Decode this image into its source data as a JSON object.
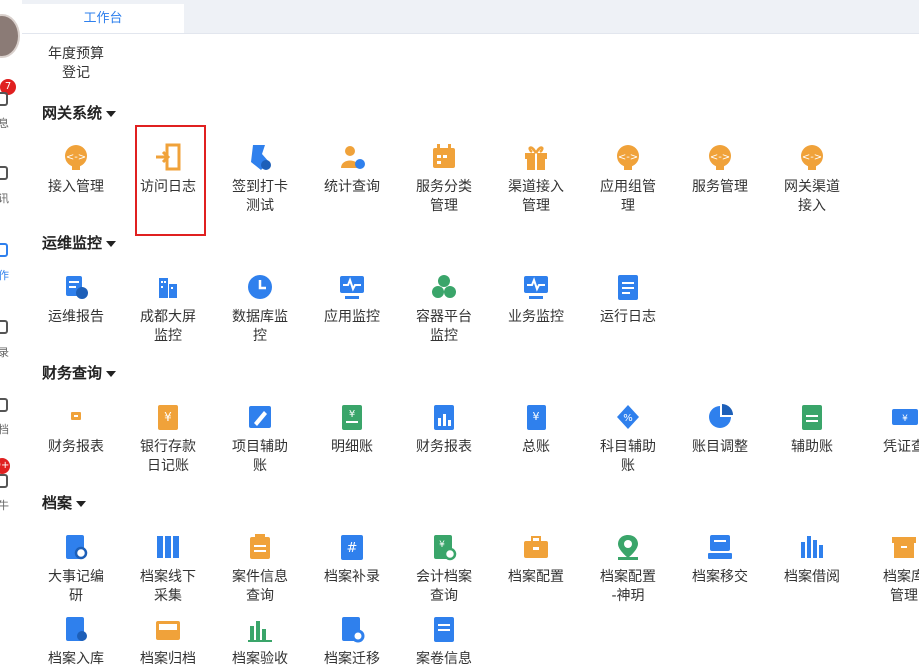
{
  "tabs": {
    "active": "工作台"
  },
  "rail": {
    "labels": [
      "息",
      "讯",
      "作",
      "录",
      "档",
      "牛"
    ],
    "badges": [
      "7",
      "9+"
    ]
  },
  "colors": {
    "accent": "#2f80ed",
    "orange": "#f0a23a",
    "green": "#3aa56a",
    "highlight": "#e02020"
  },
  "top_partial": {
    "label": "年度预算\n登记",
    "icon": "edit-icon"
  },
  "sections": [
    {
      "title": "网关系统",
      "items": [
        {
          "label": "接入管理",
          "icon": "gateway-icon"
        },
        {
          "label": "访问日志",
          "icon": "login-door-icon"
        },
        {
          "label": "签到打卡\n测试",
          "icon": "checkin-icon"
        },
        {
          "label": "统计查询",
          "icon": "user-stat-icon"
        },
        {
          "label": "服务分类\n管理",
          "icon": "calendar-service-icon"
        },
        {
          "label": "渠道接入\n管理",
          "icon": "gift-icon"
        },
        {
          "label": "应用组管\n理",
          "icon": "gateway-icon"
        },
        {
          "label": "服务管理",
          "icon": "gateway-icon"
        },
        {
          "label": "网关渠道\n接入",
          "icon": "gateway-icon"
        }
      ]
    },
    {
      "title": "运维监控",
      "items": [
        {
          "label": "运维报告",
          "icon": "report-gear-icon"
        },
        {
          "label": "成都大屏\n监控",
          "icon": "building-icon"
        },
        {
          "label": "数据库监\n控",
          "icon": "clock-icon"
        },
        {
          "label": "应用监控",
          "icon": "monitor-pulse-icon"
        },
        {
          "label": "容器平台\n监控",
          "icon": "hex-cluster-icon"
        },
        {
          "label": "业务监控",
          "icon": "monitor-pulse-icon"
        },
        {
          "label": "运行日志",
          "icon": "document-log-icon"
        }
      ]
    },
    {
      "title": "财务查询",
      "items": [
        {
          "label": "财务报表",
          "icon": "small-box-icon"
        },
        {
          "label": "银行存款\n日记账",
          "icon": "yen-ledger-icon"
        },
        {
          "label": "项目辅助\n账",
          "icon": "pencil-doc-icon"
        },
        {
          "label": "明细账",
          "icon": "yen-doc-icon"
        },
        {
          "label": "财务报表",
          "icon": "bar-doc-icon"
        },
        {
          "label": "总账",
          "icon": "yen-book-icon"
        },
        {
          "label": "科目辅助\n账",
          "icon": "percent-icon"
        },
        {
          "label": "账目调整",
          "icon": "pie-adjust-icon"
        },
        {
          "label": "辅助账",
          "icon": "aux-doc-icon"
        },
        {
          "label": "凭证查",
          "icon": "voucher-icon"
        }
      ]
    },
    {
      "title": "档案",
      "items": [
        {
          "label": "大事记编\n研",
          "icon": "doc-search-icon"
        },
        {
          "label": "档案线下\n采集",
          "icon": "binders-icon"
        },
        {
          "label": "案件信息\n查询",
          "icon": "clipboard-icon"
        },
        {
          "label": "档案补录",
          "icon": "hash-doc-icon"
        },
        {
          "label": "会计档案\n查询",
          "icon": "yen-search-icon"
        },
        {
          "label": "档案配置",
          "icon": "briefcase-icon"
        },
        {
          "label": "档案配置\n-神玥",
          "icon": "map-pin-icon"
        },
        {
          "label": "档案移交",
          "icon": "tray-transfer-icon"
        },
        {
          "label": "档案借阅",
          "icon": "bars-icon"
        },
        {
          "label": "档案库\n管理",
          "icon": "archive-box-icon"
        }
      ]
    },
    {
      "title": "",
      "items": [
        {
          "label": "档案入库",
          "icon": "doc-in-icon"
        },
        {
          "label": "档案归档",
          "icon": "inbox-icon"
        },
        {
          "label": "档案验收",
          "icon": "chart-icon"
        },
        {
          "label": "档案迁移",
          "icon": "doc-gear-icon"
        },
        {
          "label": "案卷信息",
          "icon": "folder-doc-icon"
        }
      ]
    }
  ]
}
